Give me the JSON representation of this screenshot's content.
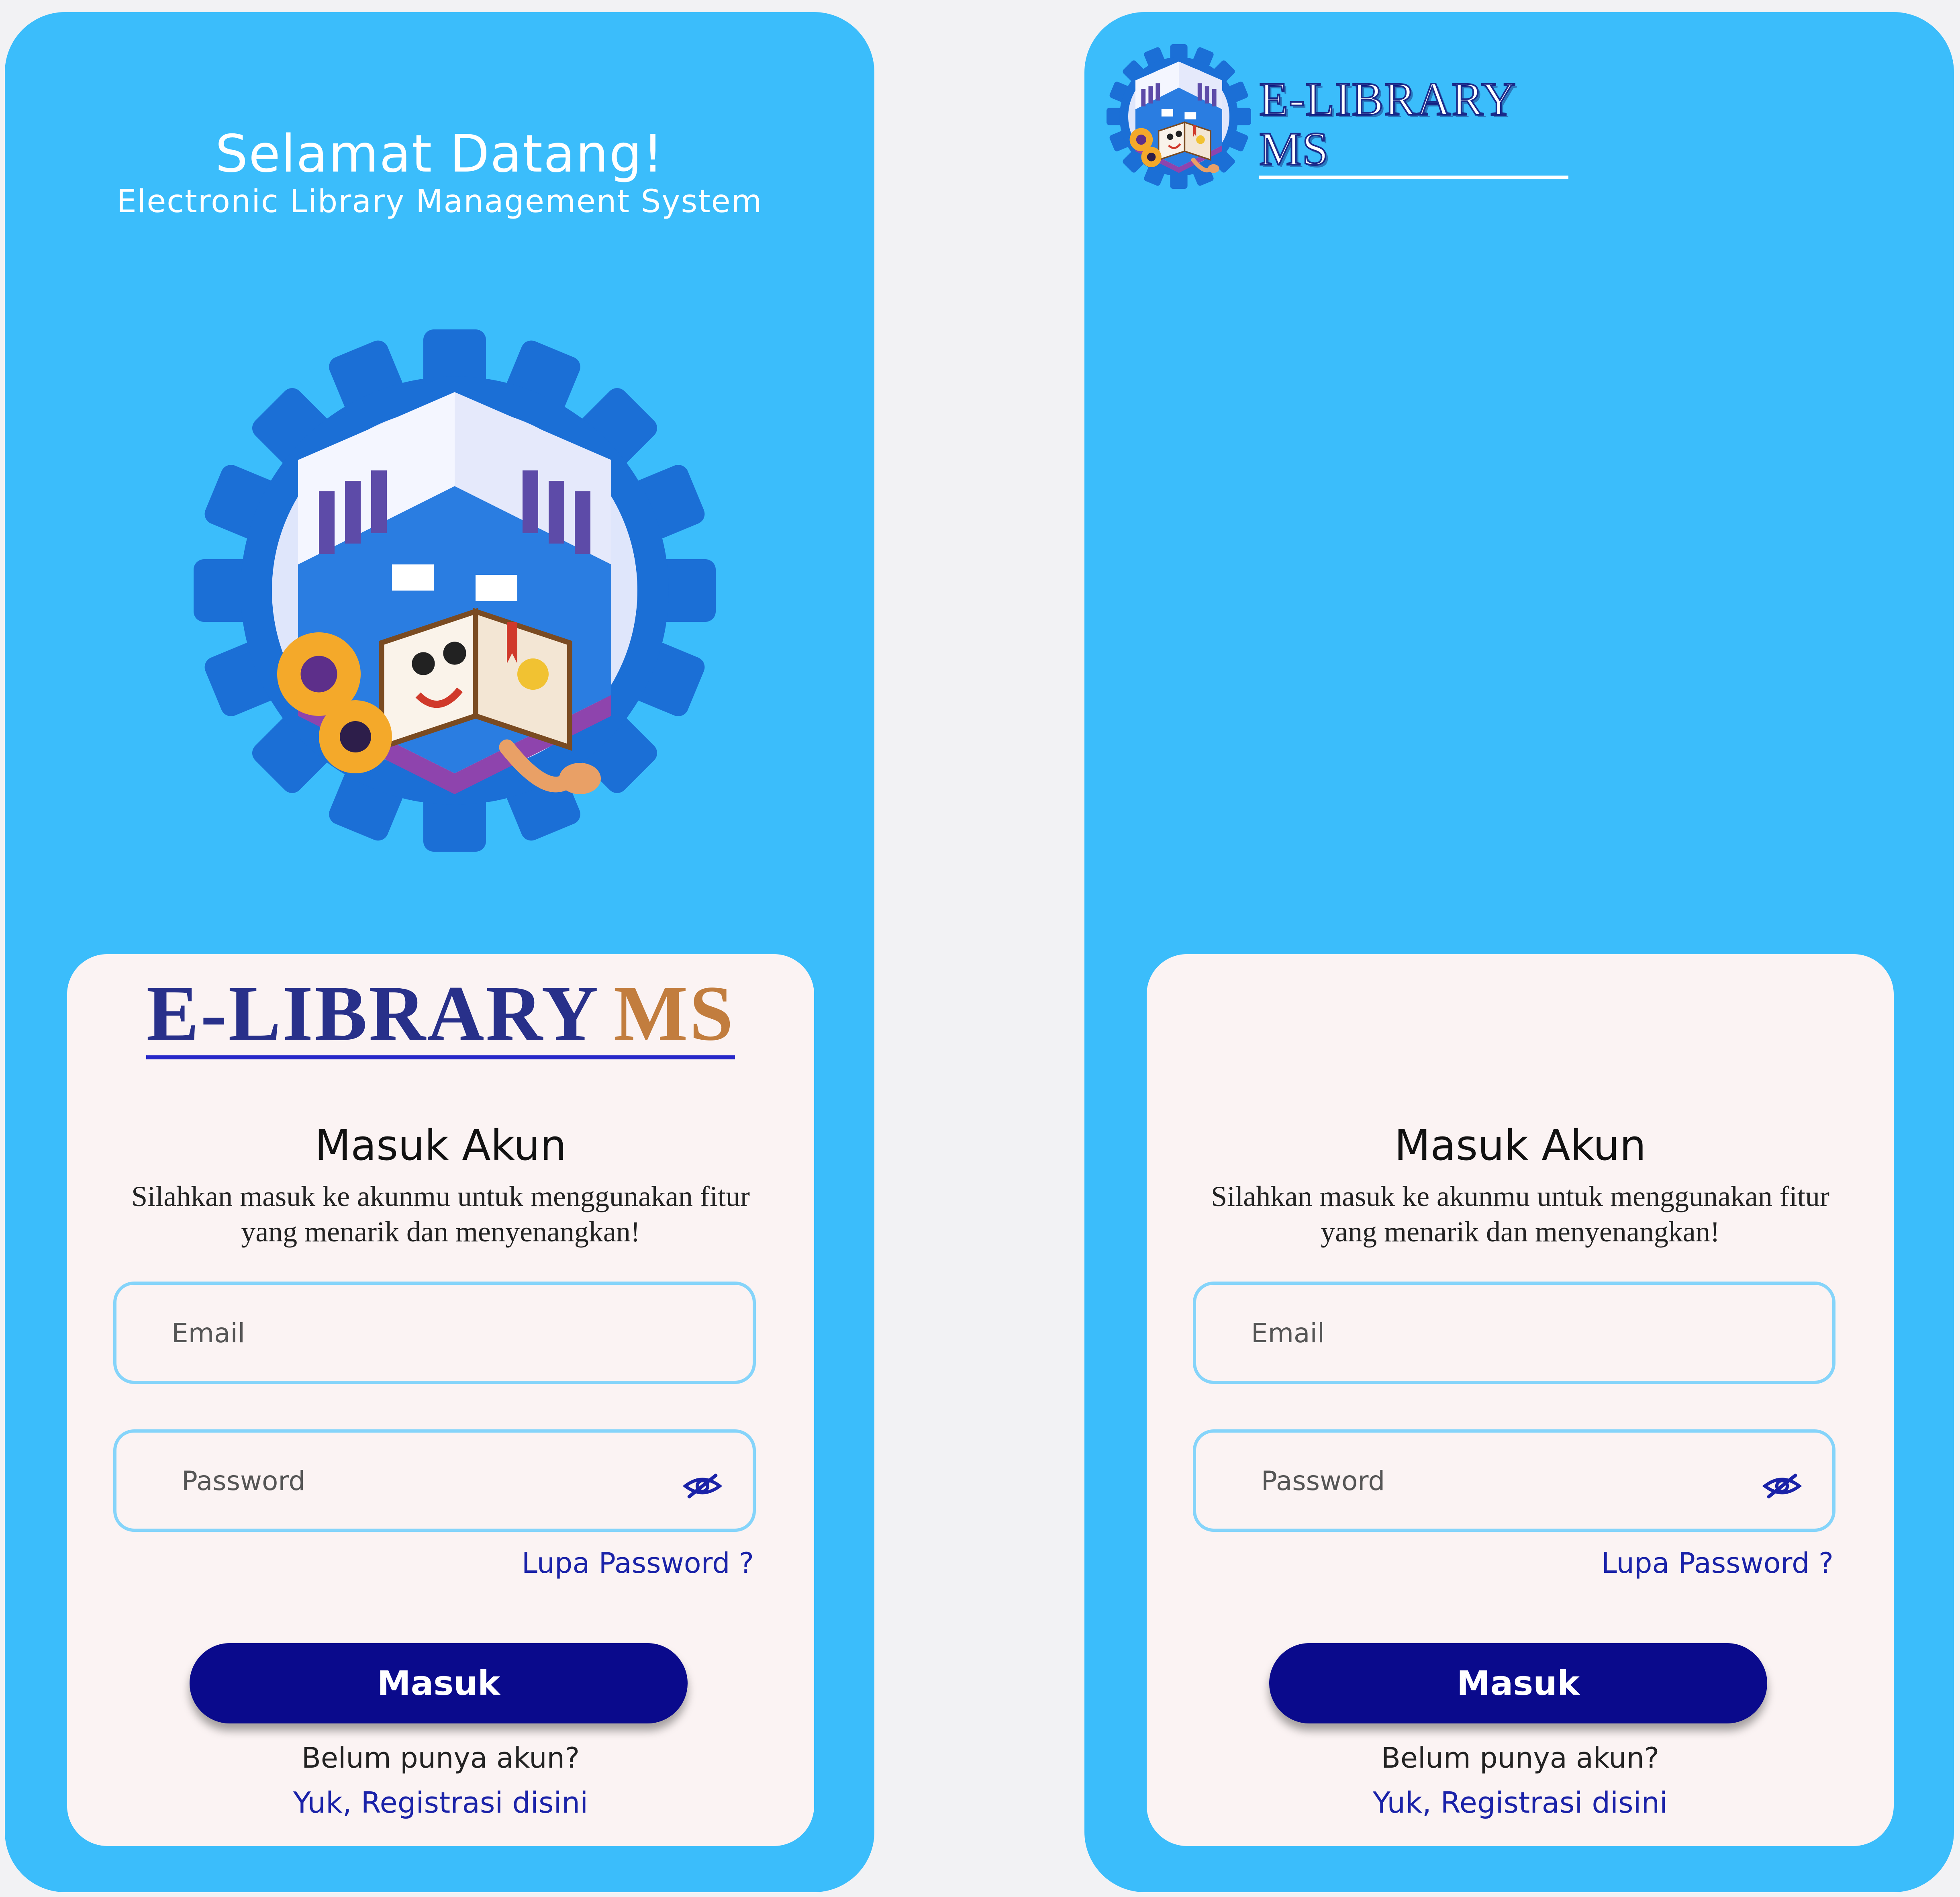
{
  "colors": {
    "page_background": "#f2f2f4",
    "screen_background": "#3bbdfb",
    "card_background": "#fbf3f3",
    "primary_button": "#0a0a8c",
    "link": "#1a22a8",
    "input_border": "#85d4fa"
  },
  "left_screen": {
    "welcome_title": "Selamat Datang!",
    "welcome_subtitle": "Electronic Library Management System",
    "hero_icon": "library-gear-book-illustration"
  },
  "right_screen": {
    "header_logo": {
      "icon": "library-gear-book-badge",
      "wordmark": "E-LIBRARY MS"
    }
  },
  "login_card": {
    "logo_part1": "E-LIBRARY",
    "logo_part2": "MS",
    "title": "Masuk Akun",
    "description": "Silahkan masuk ke akunmu untuk menggunakan fitur yang menarik dan menyenangkan!",
    "email_placeholder": "Email",
    "password_placeholder": "Password",
    "password_toggle_icon": "eye-slash-icon",
    "forgot_password": "Lupa Password ?",
    "submit_label": "Masuk",
    "no_account_text": "Belum punya akun?",
    "register_link": "Yuk, Registrasi disini"
  }
}
